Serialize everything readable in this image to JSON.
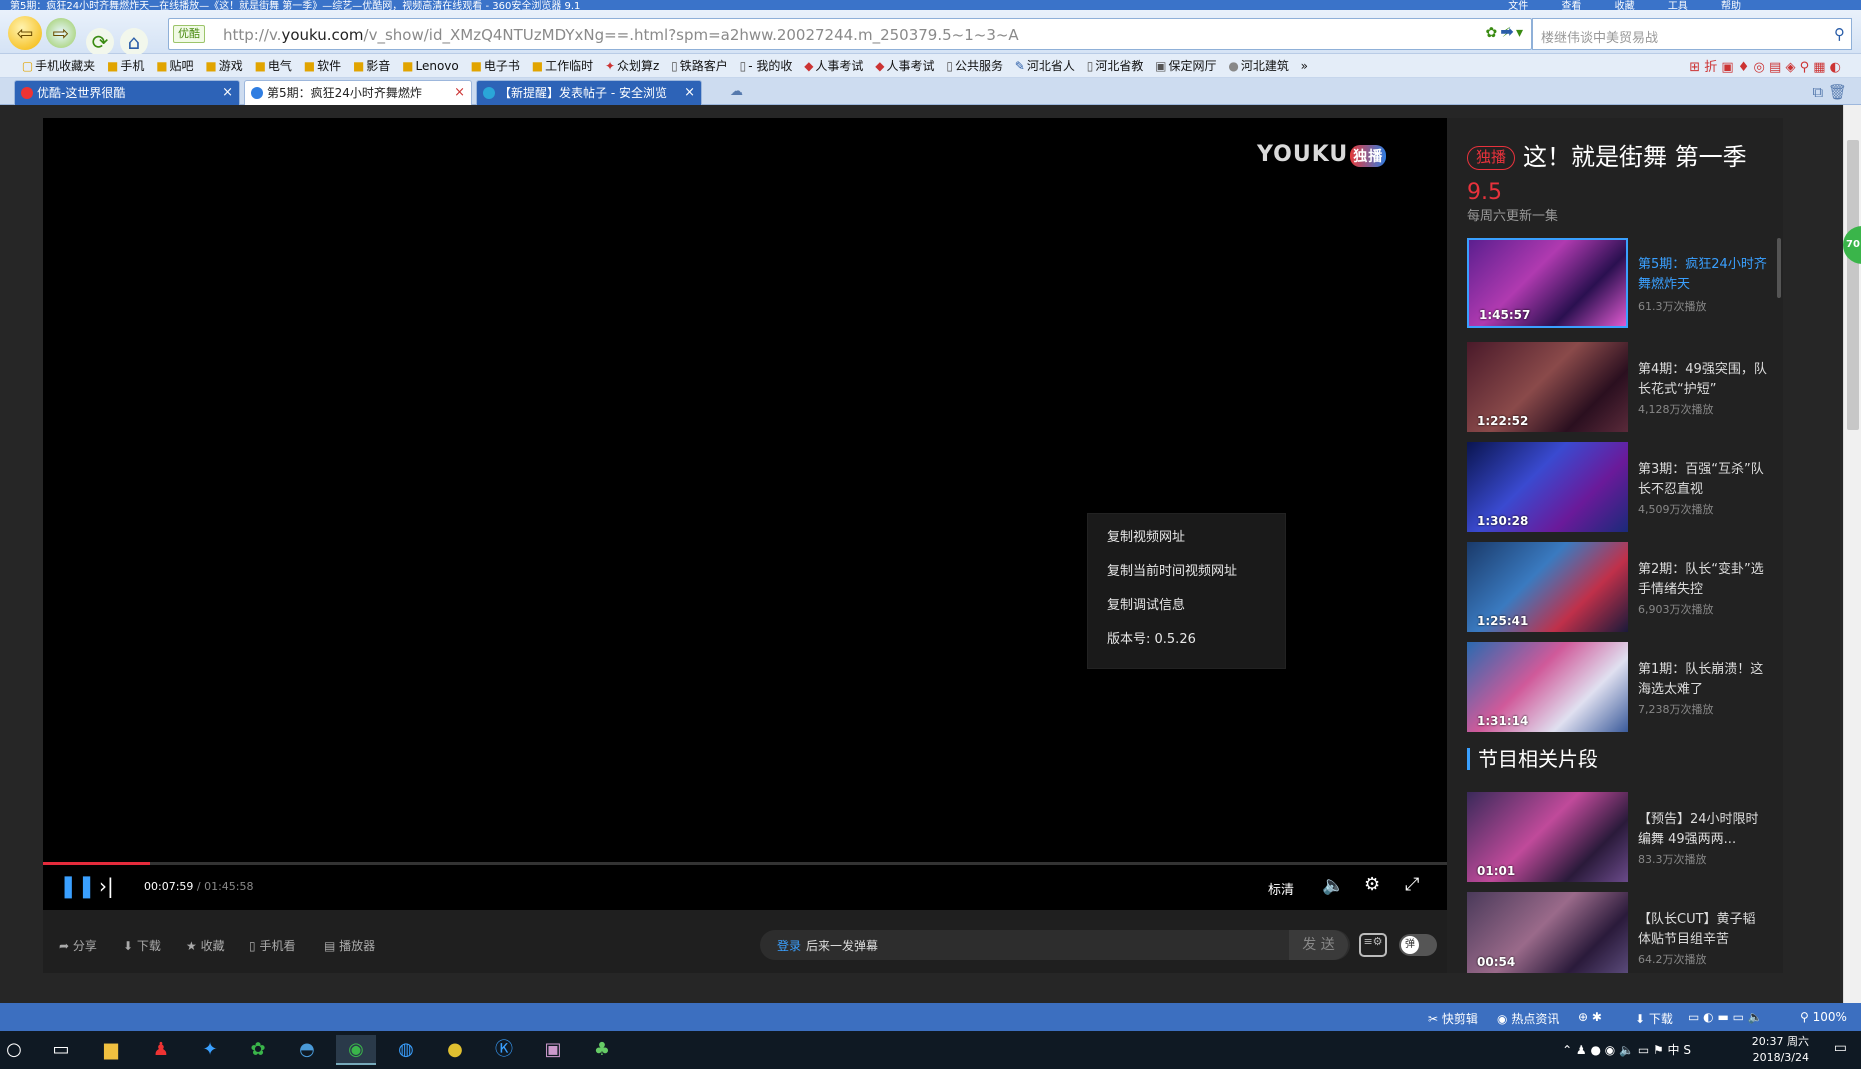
{
  "window": {
    "title": "第5期：疯狂24小时齐舞燃炸天—在线播放—《这！就是街舞 第一季》—综艺—优酷网，视频高清在线观看 - 360安全浏览器 9.1",
    "menus": [
      "文件",
      "查看",
      "收藏",
      "工具",
      "帮助"
    ]
  },
  "address_bar": {
    "badge": "优酷",
    "url_prefix": "http://v.",
    "url_domain": "youku.com",
    "url_rest": "/v_show/id_XMzQ4NTUzMDYxNg==.html?spm=a2hww.20027244.m_250379.5~1~3~A"
  },
  "search_box": {
    "placeholder": "楼继伟谈中美贸易战"
  },
  "bookmarks": [
    "手机收藏夹",
    "手机",
    "贴吧",
    "游戏",
    "电气",
    "软件",
    "影音",
    "Lenovo",
    "电子书",
    "工作临时",
    "众划算z",
    "铁路客户",
    "- 我的收",
    "人事考试",
    "人事考试",
    "公共服务",
    "河北省人",
    "河北省教",
    "保定网厅",
    "河北建筑"
  ],
  "tabs": [
    {
      "label": "优酷-这世界很酷"
    },
    {
      "label": "第5期：疯狂24小时齐舞燃炸"
    },
    {
      "label": "【新提醒】发表帖子 - 安全浏览"
    }
  ],
  "player": {
    "logo": "YOUKU",
    "logo_badge": "独播",
    "context_menu": [
      "复制视频网址",
      "复制当前时间视频网址",
      "复制调试信息",
      "版本号: 0.5.26"
    ],
    "current_time": "00:07:59",
    "total_time": " / 01:45:58",
    "progress_fraction": 0.076,
    "quality": "标清"
  },
  "bottom_actions": [
    "分享",
    "下载",
    "收藏",
    "手机看",
    "播放器"
  ],
  "danmu": {
    "login": "登录",
    "placeholder": "后来一发弹幕",
    "send": "发 送",
    "toggle": "弹"
  },
  "sidebar": {
    "tag": "独播",
    "title": "这！就是街舞 第一季",
    "score": "9.5",
    "update": "每周六更新一集",
    "episodes": [
      {
        "duration": "1:45:57",
        "name": "第5期：疯狂24小时齐舞燃炸天",
        "views": "61.3万次播放",
        "current": true
      },
      {
        "duration": "1:22:52",
        "name": "第4期：49强突围，队长花式“护短”",
        "views": "4,128万次播放"
      },
      {
        "duration": "1:30:28",
        "name": "第3期：百强“互杀”队长不忍直视",
        "views": "4,509万次播放"
      },
      {
        "duration": "1:25:41",
        "name": "第2期：队长“变卦”选手情绪失控",
        "views": "6,903万次播放"
      },
      {
        "duration": "1:31:14",
        "name": "第1期：队长崩溃！这海选太难了",
        "views": "7,238万次播放"
      }
    ],
    "section_title": "节目相关片段",
    "clips": [
      {
        "duration": "01:01",
        "name": "【预告】24小时限时编舞 49强两两...",
        "views": "83.3万次播放"
      },
      {
        "duration": "00:54",
        "name": "【队长CUT】黄子韬体贴节目组辛苦",
        "views": "64.2万次播放"
      }
    ]
  },
  "status_bar": {
    "items": [
      "快剪辑",
      "热点资讯",
      "下载",
      "100%"
    ]
  },
  "clock": {
    "time": "20:37 周六",
    "date": "2018/3/24"
  },
  "side_button": "70"
}
